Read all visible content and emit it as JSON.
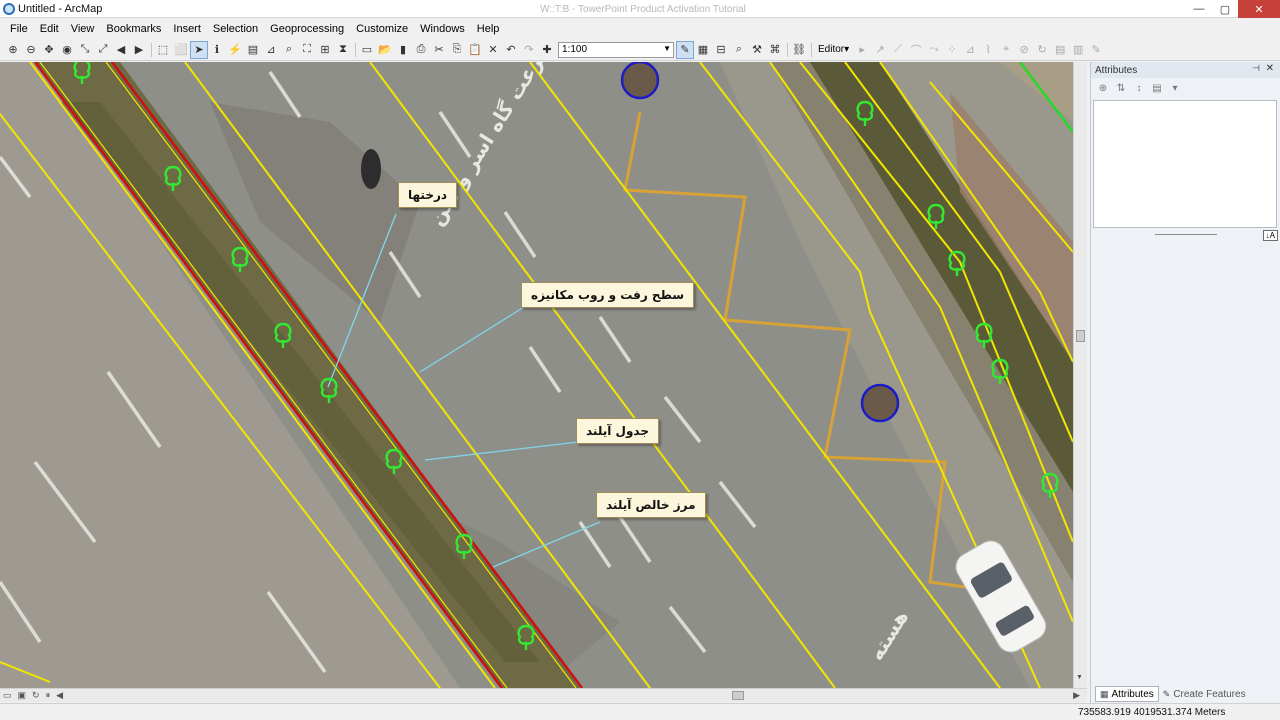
{
  "window": {
    "title": "Untitled - ArcMap",
    "blurred_title": "W::T:B - TowerPoint Product Activation Tutorial",
    "buttons": [
      "—",
      "▢",
      "✕"
    ]
  },
  "menu": [
    "File",
    "Edit",
    "View",
    "Bookmarks",
    "Insert",
    "Selection",
    "Geoprocessing",
    "Customize",
    "Windows",
    "Help"
  ],
  "toolbar": {
    "scale_value": "1:100",
    "editor_label": "Editor▾",
    "tools": {
      "zoom_in": "⊕",
      "zoom_out": "⊖",
      "pan": "✥",
      "globe": "◉",
      "fixed_in": "⤡",
      "fixed_out": "⤢",
      "back": "◀",
      "forward": "▶",
      "select_features": "⬚",
      "clear_selection": "⬜",
      "select_arrow": "➤",
      "identify": "ℹ",
      "hyperlink": "⚡",
      "html_popup": "▤",
      "measure": "⊿",
      "find": "⌕",
      "find_route": "⛶",
      "go_xy": "⊞",
      "time_slider": "⧗",
      "new_doc": "▭",
      "open": "📂",
      "save": "▮",
      "print": "⎙",
      "cut": "✂",
      "copy": "⎘",
      "paste": "📋",
      "delete": "✕",
      "undo": "↶",
      "redo": "↷",
      "add_data": "✚",
      "editor_tool": "✎",
      "table": "▦",
      "catalog": "⊟",
      "search": "⌕",
      "arc_toolbox": "⚒",
      "python": "⌘",
      "model_builder": "⛓"
    }
  },
  "map": {
    "callouts": [
      {
        "id": "trees",
        "text": "درختها"
      },
      {
        "id": "paved_surface",
        "text": "سطح رفت و روب مکانیزه"
      },
      {
        "id": "island_curb",
        "text": "جدول آیلند"
      },
      {
        "id": "net_island_boundary",
        "text": "مرز خالص آیلند"
      }
    ],
    "road_markings": [
      "سرعت گاه اسر و شن",
      "هسته"
    ],
    "colors": {
      "asphalt": "#8f8f8a",
      "median": "#6f6d48",
      "line_yellow": "#f2e600",
      "line_red": "#cc1111",
      "tree_symbol": "#33e833",
      "circle_blue": "#1c1cc7",
      "leader_line": "#7fd8ea",
      "lane_orange": "#d9a236"
    }
  },
  "attributes_panel": {
    "title": "Attributes",
    "pin": "⊣",
    "close": "✕",
    "tabs": [
      {
        "label": "Attributes",
        "active": true
      },
      {
        "label": "Create Features",
        "active": false
      }
    ]
  },
  "status": {
    "coordinates": "735583.919  4019531.374 Meters"
  }
}
